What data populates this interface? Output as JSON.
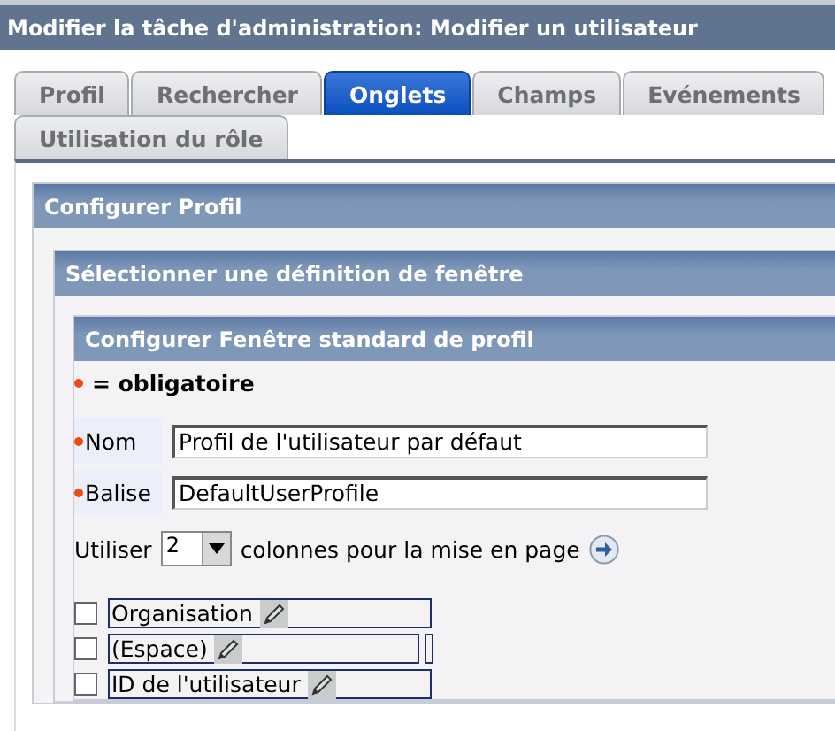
{
  "window": {
    "title": "Modifier la tâche d'administration: Modifier un utilisateur"
  },
  "tabs": [
    {
      "label": "Profil",
      "selected": false
    },
    {
      "label": "Rechercher",
      "selected": false
    },
    {
      "label": "Onglets",
      "selected": true
    },
    {
      "label": "Champs",
      "selected": false
    },
    {
      "label": "Evénements",
      "selected": false
    },
    {
      "label": "Utilisation du rôle",
      "selected": false
    }
  ],
  "sections": [
    "Configurer Profil",
    "Sélectionner une définition de fenêtre",
    "Configurer Fenêtre standard de profil"
  ],
  "legend": "= obligatoire",
  "fields": [
    {
      "label": "Nom",
      "value": "Profil de l'utilisateur par défaut",
      "required": true
    },
    {
      "label": "Balise",
      "value": "DefaultUserProfile",
      "required": true
    }
  ],
  "columns": {
    "before": "Utiliser",
    "value": "2",
    "after": "colonnes pour la mise en page"
  },
  "items": [
    {
      "label": "Organisation",
      "checked": false,
      "extra_slot": false
    },
    {
      "label": "(Espace)",
      "checked": false,
      "extra_slot": true
    },
    {
      "label": "ID de l'utilisateur",
      "checked": false,
      "extra_slot": false
    }
  ]
}
